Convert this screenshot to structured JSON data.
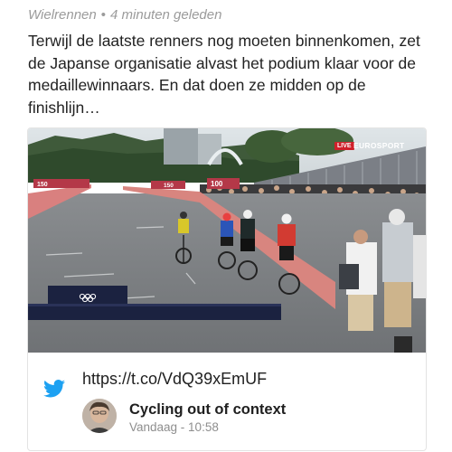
{
  "post": {
    "category": "Wielrennen",
    "separator": "•",
    "time_ago": "4 minuten geleden",
    "text": "Terwijl de laatste renners nog moeten binnenkomen, zet de Japanse organisatie alvast het podium klaar voor de medaillewinnaars. En dat doen ze midden op de finishlijn…"
  },
  "embed": {
    "live_badge": "LIVE",
    "broadcaster": "EUROSPORT",
    "link": "https://t.co/VdQ39xEmUF",
    "author": "Cycling out of context",
    "timestamp": "Vandaag - 10:58",
    "banners": {
      "left": "150",
      "middle": "150",
      "right": "100"
    },
    "colors": {
      "twitter_blue": "#1da1f2",
      "live_red": "#d0202a"
    },
    "icons": {
      "twitter": "twitter-bird-icon",
      "olympic_rings": "olympic-rings-icon"
    }
  }
}
